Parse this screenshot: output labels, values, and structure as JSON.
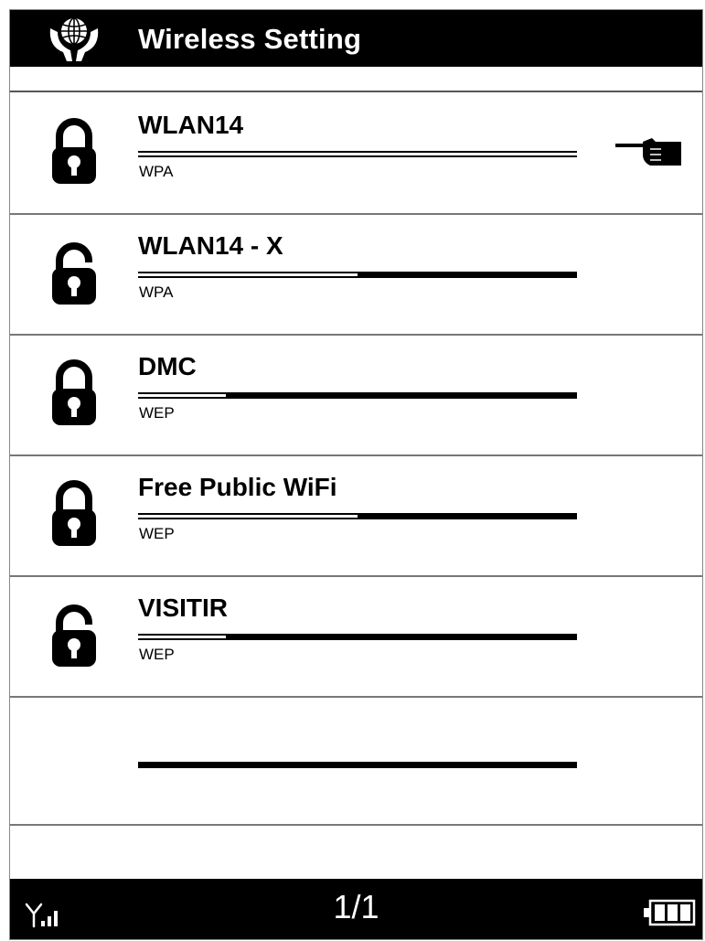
{
  "header": {
    "title": "Wireless Setting",
    "logo_icon": "globe-in-hands-icon"
  },
  "networks": [
    {
      "ssid": "WLAN14",
      "security": "WPA",
      "signal_percent": 100,
      "lock": "locked",
      "selected": true
    },
    {
      "ssid": "WLAN14 - X",
      "security": "WPA",
      "signal_percent": 50,
      "lock": "unlocked",
      "selected": false
    },
    {
      "ssid": "DMC",
      "security": "WEP",
      "signal_percent": 20,
      "lock": "locked",
      "selected": false
    },
    {
      "ssid": "Free Public WiFi",
      "security": "WEP",
      "signal_percent": 50,
      "lock": "locked",
      "selected": false
    },
    {
      "ssid": "VISITIR",
      "security": "WEP",
      "signal_percent": 20,
      "lock": "unlocked",
      "selected": false
    }
  ],
  "empty_row": {
    "signal_percent": 0
  },
  "footer": {
    "page": "1/1",
    "signal_icon": "antenna-signal-icon",
    "battery_icon": "battery-full-icon"
  }
}
